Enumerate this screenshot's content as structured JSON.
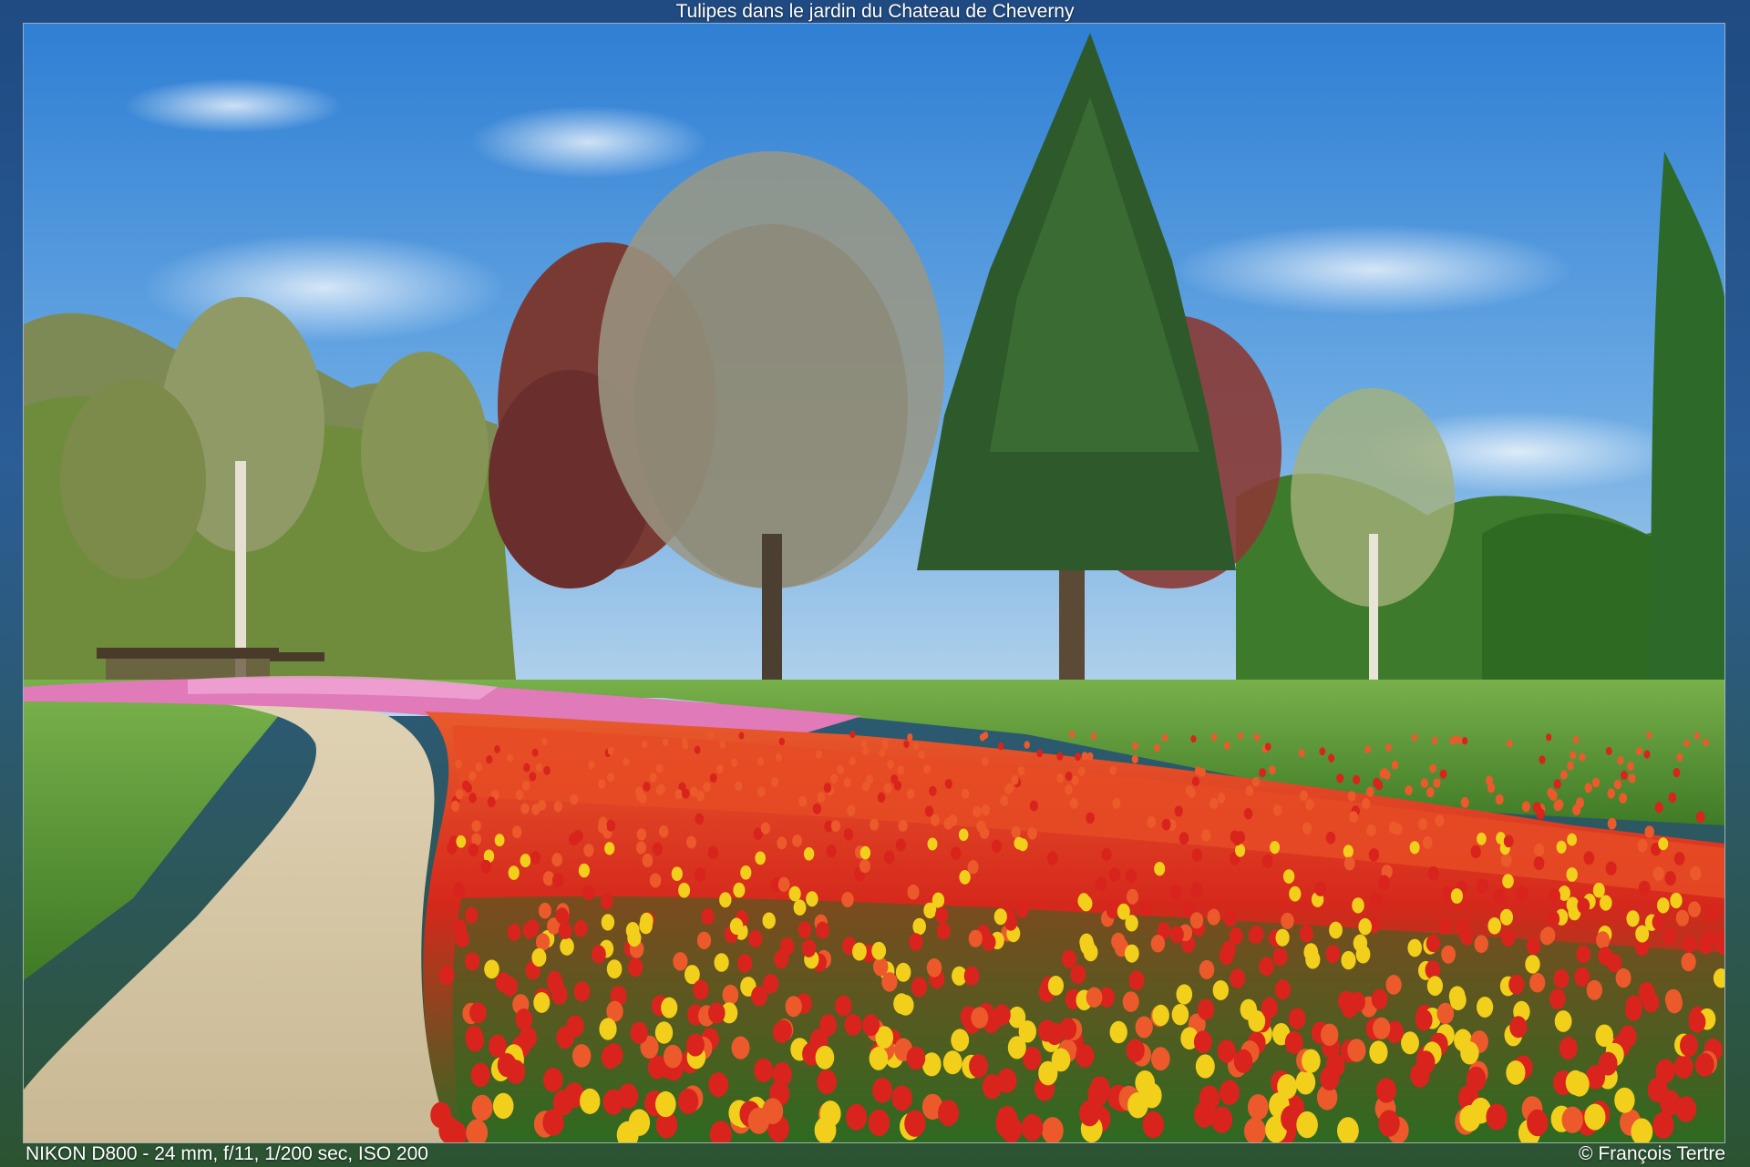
{
  "photo": {
    "title": "Tulipes dans le jardin du Chateau de Cheverny",
    "exif": "NIKON D800 - 24 mm, f/11, 1/200 sec, ISO 200",
    "credit": "© François Tertre"
  },
  "colors": {
    "sky_top": "#2f7fd4",
    "sky_bottom": "#a9cde9",
    "grass": "#5f9a3a",
    "path": "#d2c2a2",
    "tulip_red": "#d8241c",
    "tulip_orange": "#ec5a2c",
    "tulip_pink": "#e07ab8",
    "tulip_yellow": "#f2cf1a"
  }
}
